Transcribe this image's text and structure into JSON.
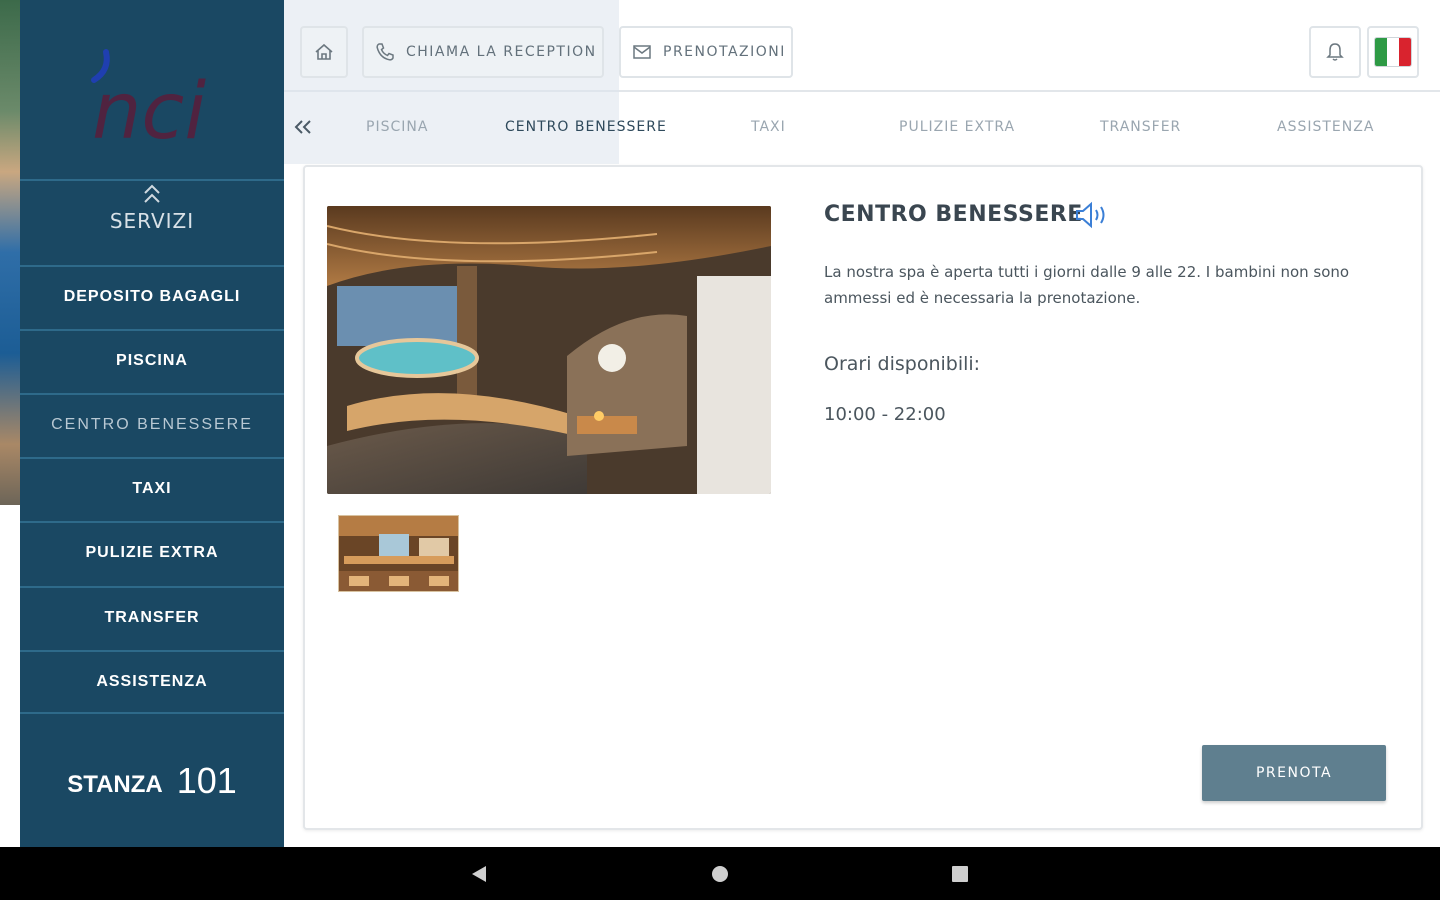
{
  "header": {
    "call_reception": "CHIAMA LA RECEPTION",
    "bookings": "PRENOTAZIONI"
  },
  "sidebar": {
    "logo_text": "nci",
    "services_title": "SERVIZI",
    "items": [
      {
        "label": "DEPOSITO BAGAGLI"
      },
      {
        "label": "PISCINA"
      },
      {
        "label": "CENTRO BENESSERE"
      },
      {
        "label": "TAXI"
      },
      {
        "label": "PULIZIE EXTRA"
      },
      {
        "label": "TRANSFER"
      },
      {
        "label": "ASSISTENZA"
      }
    ],
    "room_label": "STANZA",
    "room_number": "101"
  },
  "tabs": [
    {
      "label": "PISCINA"
    },
    {
      "label": "CENTRO BENESSERE"
    },
    {
      "label": "TAXI"
    },
    {
      "label": "PULIZIE EXTRA"
    },
    {
      "label": "TRANSFER"
    },
    {
      "label": "ASSISTENZA"
    }
  ],
  "active_tab": "CENTRO BENESSERE",
  "detail": {
    "title": "CENTRO BENESSERE",
    "description": "La nostra spa è aperta tutti i giorni dalle 9 alle 22. I bambini non sono ammessi ed è necessaria la prenotazione.",
    "hours_label": "Orari disponibili:",
    "hours_value": "10:00 - 22:00",
    "book_button": "PRENOTA"
  },
  "colors": {
    "sidebar": "#1a4863",
    "cta": "#5f7f8f",
    "flag": [
      "#2e9a45",
      "#ffffff",
      "#d9232e"
    ]
  },
  "icons": [
    "home-icon",
    "phone-icon",
    "mail-icon",
    "bell-icon",
    "italy-flag-icon",
    "chevron-up-icon",
    "double-chevron-left-icon",
    "speaker-icon"
  ]
}
